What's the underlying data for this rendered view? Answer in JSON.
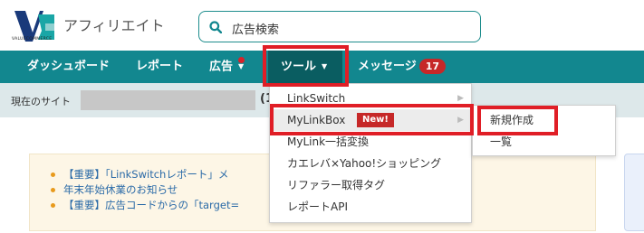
{
  "header": {
    "app_title": "アフィリエイト",
    "logo_sub": "VALUECOMMERCE",
    "search": {
      "value": "広告検索",
      "icon": "search-icon"
    }
  },
  "nav": {
    "items": [
      {
        "label": "ダッシュボード"
      },
      {
        "label": "レポート"
      },
      {
        "label": "広告"
      },
      {
        "label": "ツール"
      },
      {
        "label": "メッセージ",
        "badge": "17"
      }
    ]
  },
  "site_bar": {
    "label": "現在のサイト",
    "suffix": "(1"
  },
  "tools_menu": {
    "items": [
      {
        "label": "LinkSwitch"
      },
      {
        "label": "MyLinkBox",
        "badge": "New!"
      },
      {
        "label": "MyLink一括変換"
      },
      {
        "label": "カエレバ×Yahoo!ショッピング"
      },
      {
        "label": "リファラー取得タグ"
      },
      {
        "label": "レポートAPI"
      }
    ],
    "submenu": [
      {
        "label": "新規作成"
      },
      {
        "label": "一覧"
      }
    ]
  },
  "notices": [
    {
      "text": "【重要】「LinkSwitchレポート」メ"
    },
    {
      "text": "年末年始休業のお知らせ"
    },
    {
      "text": "【重要】広告コードからの「target="
    }
  ],
  "colors": {
    "nav_bg": "#12878f",
    "nav_active": "#0a5d61",
    "highlight": "#e01e26",
    "badge": "#c62828"
  }
}
